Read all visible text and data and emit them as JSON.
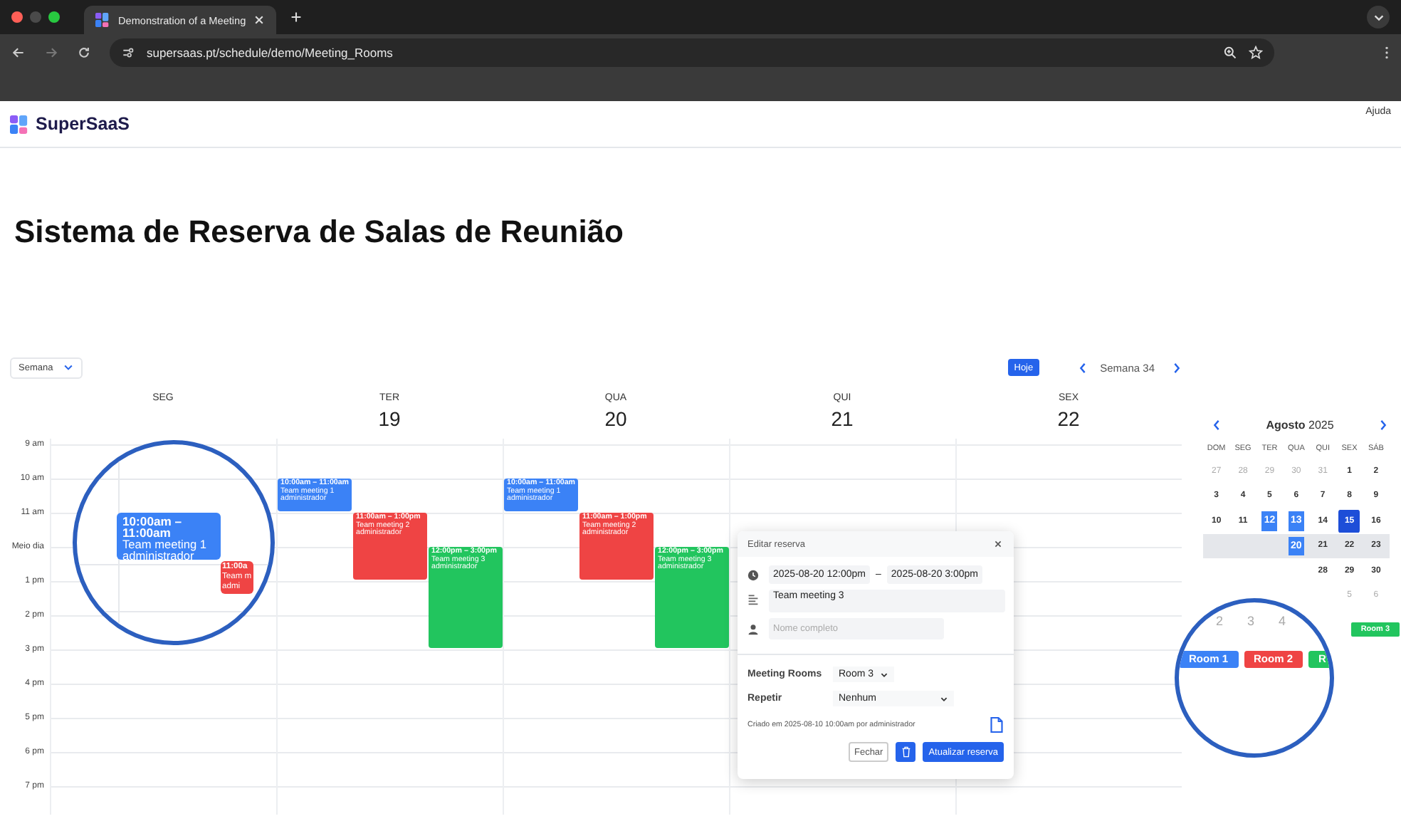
{
  "browser": {
    "tab_title": "Demonstration of a Meeting",
    "url": "supersaas.pt/schedule/demo/Meeting_Rooms"
  },
  "header": {
    "logo": "SuperSaaS",
    "help": "Ajuda"
  },
  "title": "Sistema de Reserva de Salas de Reunião",
  "toolbar": {
    "view": "Semana",
    "today": "Hoje",
    "week": "Semana 34"
  },
  "time_labels": [
    "9 am",
    "10 am",
    "11 am",
    "Meio dia",
    "1 pm",
    "2 pm",
    "3 pm",
    "4 pm",
    "5 pm",
    "6 pm",
    "7 pm"
  ],
  "days": [
    {
      "name": "SEG"
    },
    {
      "name": "TER",
      "date": "19",
      "events": [
        {
          "kind": "room1",
          "color": "#3b82f6",
          "time": "10:00am – 11:00am",
          "title": "Team meeting 1",
          "owner": "administrador"
        },
        {
          "kind": "room2",
          "color": "#ef4444",
          "time": "11:00am – 1:00pm",
          "title": "Team meeting 2",
          "owner": "administrador"
        },
        {
          "kind": "room3",
          "color": "#22c55e",
          "time": "12:00pm – 3:00pm",
          "title": "Team meeting 3",
          "owner": "administrador"
        }
      ]
    },
    {
      "name": "QUA",
      "date": "20",
      "events": [
        {
          "kind": "room1",
          "color": "#3b82f6",
          "time": "10:00am – 11:00am",
          "title": "Team meeting 1",
          "owner": "administrador"
        },
        {
          "kind": "room2",
          "color": "#ef4444",
          "time": "11:00am – 1:00pm",
          "title": "Team meeting 2",
          "owner": "administrador"
        },
        {
          "kind": "room3",
          "color": "#22c55e",
          "time": "12:00pm – 3:00pm",
          "title": "Team meeting 3",
          "owner": "administrador"
        }
      ]
    },
    {
      "name": "QUI",
      "date": "21"
    },
    {
      "name": "SEX",
      "date": "22"
    }
  ],
  "magnifier_left": {
    "events": [
      {
        "kind": "room1",
        "color": "#3b82f6",
        "time": "10:00am – 11:00am",
        "title": "Team meeting 1",
        "owner": "administrador"
      },
      {
        "kind": "room2",
        "color": "#ef4444",
        "time": "11:00a",
        "title": "Team m",
        "owner": "admi"
      }
    ]
  },
  "dialog": {
    "title": "Editar reserva",
    "start": "2025-08-20 12:00pm",
    "separator": "–",
    "end": "2025-08-20 3:00pm",
    "description": "Team meeting 3",
    "name_placeholder": "Nome completo",
    "resource_label": "Meeting Rooms",
    "resource": "Room 3",
    "repeat_label": "Repetir",
    "repeat": "Nenhum",
    "meta": "Criado em 2025-08-10 10:00am por administrador",
    "close": "Fechar",
    "update": "Atualizar reserva"
  },
  "mini_calendar": {
    "month": "Agosto",
    "year": "2025",
    "weekdays": [
      "DOM",
      "SEG",
      "TER",
      "QUA",
      "QUI",
      "SEX",
      "SÁB"
    ],
    "weeks": [
      {
        "current": false,
        "days": [
          {
            "day": "27",
            "kind": "muted"
          },
          {
            "day": "28",
            "kind": "muted"
          },
          {
            "day": "29",
            "kind": "muted"
          },
          {
            "day": "30",
            "kind": "muted"
          },
          {
            "day": "31",
            "kind": "muted"
          },
          {
            "day": "1",
            "kind": "normal"
          },
          {
            "day": "2",
            "kind": "normal"
          }
        ]
      },
      {
        "current": false,
        "days": [
          {
            "day": "3",
            "kind": "normal"
          },
          {
            "day": "4",
            "kind": "normal"
          },
          {
            "day": "5",
            "kind": "normal"
          },
          {
            "day": "6",
            "kind": "normal"
          },
          {
            "day": "7",
            "kind": "normal"
          },
          {
            "day": "8",
            "kind": "normal"
          },
          {
            "day": "9",
            "kind": "normal"
          }
        ]
      },
      {
        "current": false,
        "days": [
          {
            "day": "10",
            "kind": "normal"
          },
          {
            "day": "11",
            "kind": "normal"
          },
          {
            "day": "12",
            "kind": "selected"
          },
          {
            "day": "13",
            "kind": "selected"
          },
          {
            "day": "14",
            "kind": "normal"
          },
          {
            "day": "15",
            "kind": "today"
          },
          {
            "day": "16",
            "kind": "normal"
          }
        ]
      },
      {
        "current": true,
        "days": [
          {
            "day": "20",
            "kind": "selected"
          },
          {
            "day": "21",
            "kind": "normal"
          },
          {
            "day": "22",
            "kind": "normal"
          },
          {
            "day": "23",
            "kind": "normal"
          }
        ]
      },
      {
        "current": false,
        "days": [
          {
            "day": "28",
            "kind": "normal"
          },
          {
            "day": "29",
            "kind": "normal"
          },
          {
            "day": "30",
            "kind": "normal"
          }
        ]
      },
      {
        "current": false,
        "days": [
          {
            "day": "5",
            "kind": "muted"
          },
          {
            "day": "6",
            "kind": "muted"
          }
        ]
      }
    ]
  },
  "magnifier_right": {
    "days": [
      "2",
      "3",
      "4"
    ],
    "rooms": [
      {
        "label": "Room 1",
        "color": "#3b82f6"
      },
      {
        "label": "Room 2",
        "color": "#ef4444"
      },
      {
        "label": "R",
        "color": "#22c55e"
      }
    ]
  },
  "legend": [
    {
      "label": "Room 3",
      "color": "#22c55e"
    }
  ]
}
